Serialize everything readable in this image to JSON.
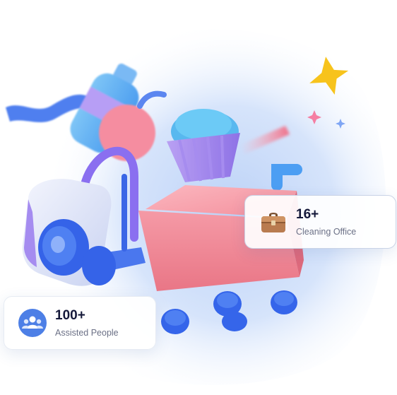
{
  "stats": {
    "office": {
      "value": "16+",
      "label": "Cleaning Office",
      "icon": "briefcase-icon"
    },
    "people": {
      "value": "100+",
      "label": "Assisted People",
      "icon": "people-group-icon"
    }
  },
  "colors": {
    "heading": "#15193a",
    "subtext": "#6b7086",
    "backdrop_blue": "#cfe0fb",
    "cart_pink": "#f39aa6",
    "accent_blue": "#3f6ff0",
    "star_yellow": "#f7c31c"
  }
}
